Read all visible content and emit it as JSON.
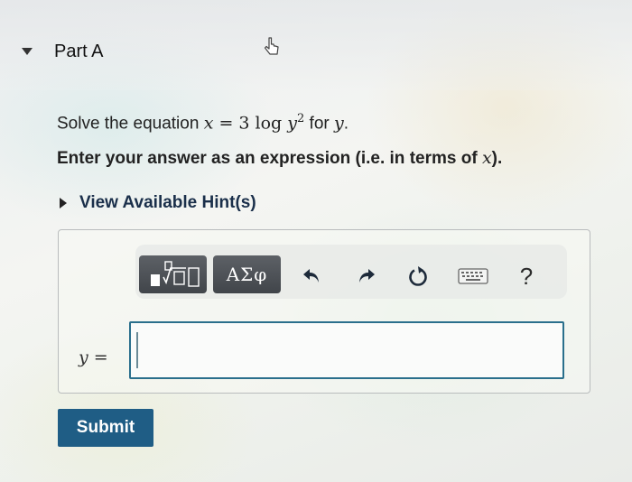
{
  "part": {
    "title": "Part A"
  },
  "question": {
    "prefix": "Solve the equation ",
    "equation_var": "x",
    "equation_eq": " = 3 log ",
    "equation_y": "y",
    "equation_exp": "2",
    "suffix": " for ",
    "target_var": "y",
    "period": "."
  },
  "instruction": {
    "text": "Enter your answer as an expression (i.e. in terms of ",
    "var": "x",
    "close": ")."
  },
  "hints": {
    "label": "View Available Hint(s)"
  },
  "toolbar": {
    "symbols_label": "ΑΣφ",
    "help_label": "?",
    "icons": [
      "templates-icon",
      "symbols-icon",
      "undo-icon",
      "redo-icon",
      "reset-icon",
      "keyboard-icon",
      "help-icon"
    ]
  },
  "answer": {
    "label_var": "y",
    "label_eq": " =",
    "value": "",
    "placeholder": ""
  },
  "submit": {
    "label": "Submit"
  },
  "colors": {
    "submit": "#1f5d85",
    "input_border": "#2a6f8c",
    "toolbar_button": "#4b4f54"
  }
}
